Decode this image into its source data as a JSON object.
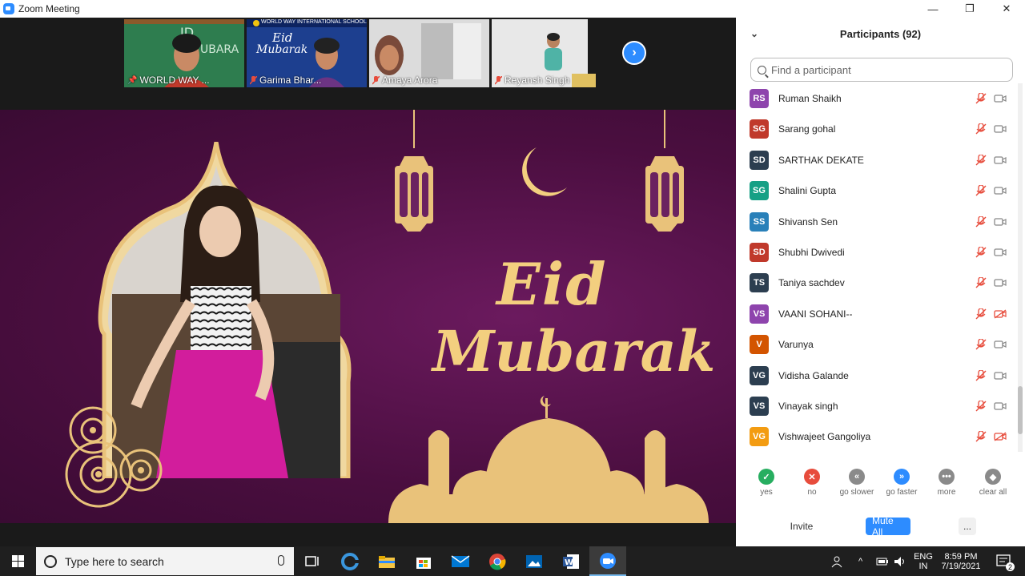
{
  "window": {
    "title": "Zoom Meeting",
    "controls": [
      "minimize",
      "restore",
      "close"
    ]
  },
  "gallery": {
    "thumbnails": [
      {
        "name": "WORLD WAY ...",
        "pinned": true,
        "muted": false
      },
      {
        "name": "Garima Bhar...",
        "pinned": false,
        "muted": true
      },
      {
        "name": "Amaya Arora",
        "pinned": false,
        "muted": true
      },
      {
        "name": "Reyansh Singh",
        "pinned": false,
        "muted": true
      }
    ],
    "thumb2_text": {
      "school": "WORLD WAY INTERNATIONAL SCHOOL",
      "eid": "Eid",
      "mubarak": "Mubarak"
    }
  },
  "stage": {
    "line1": "Eid",
    "line2": "Mubarak",
    "colors": {
      "background": "#4a0e3f",
      "gold": "#f3cf7f"
    }
  },
  "participants": {
    "header": "Participants (92)",
    "search_placeholder": "Find a participant",
    "list": [
      {
        "initials": "RS",
        "name": "Ruman Shaikh",
        "color": "#8e44ad",
        "video_off": false
      },
      {
        "initials": "SG",
        "name": "Sarang gohal",
        "color": "#c0392b",
        "video_off": false
      },
      {
        "initials": "SD",
        "name": "SARTHAK DEKATE",
        "color": "#2c3e50",
        "video_off": false
      },
      {
        "initials": "SG",
        "name": "Shalini Gupta",
        "color": "#16a085",
        "video_off": false
      },
      {
        "initials": "SS",
        "name": "Shivansh Sen",
        "color": "#2980b9",
        "video_off": false
      },
      {
        "initials": "SD",
        "name": "Shubhi Dwivedi",
        "color": "#c0392b",
        "video_off": false
      },
      {
        "initials": "TS",
        "name": "Taniya sachdev",
        "color": "#2c3e50",
        "video_off": false
      },
      {
        "initials": "VS",
        "name": "VAANI SOHANI--",
        "color": "#8e44ad",
        "video_off": true
      },
      {
        "initials": "V",
        "name": "Varunya",
        "color": "#d35400",
        "video_off": false
      },
      {
        "initials": "VG",
        "name": "Vidisha Galande",
        "color": "#2c3e50",
        "video_off": false
      },
      {
        "initials": "VS",
        "name": "Vinayak singh",
        "color": "#2c3e50",
        "video_off": false
      },
      {
        "initials": "VG",
        "name": "Vishwajeet Gangoliya",
        "color": "#f39c12",
        "video_off": true
      }
    ],
    "reactions": [
      {
        "label": "yes",
        "color": "#27ae60",
        "symbol": "✓"
      },
      {
        "label": "no",
        "color": "#e74c3c",
        "symbol": "✕"
      },
      {
        "label": "go slower",
        "color": "#8a8a8a",
        "symbol": "«"
      },
      {
        "label": "go faster",
        "color": "#2d8cff",
        "symbol": "»"
      },
      {
        "label": "more",
        "color": "#8a8a8a",
        "symbol": "•••"
      },
      {
        "label": "clear all",
        "color": "#8a8a8a",
        "symbol": "◆"
      }
    ],
    "buttons": {
      "invite": "Invite",
      "mute_all": "Mute All",
      "more": "..."
    }
  },
  "taskbar": {
    "search_placeholder": "Type here to search",
    "language_top": "ENG",
    "language_bottom": "IN",
    "time": "8:59 PM",
    "date": "7/19/2021",
    "notifications": "2"
  }
}
